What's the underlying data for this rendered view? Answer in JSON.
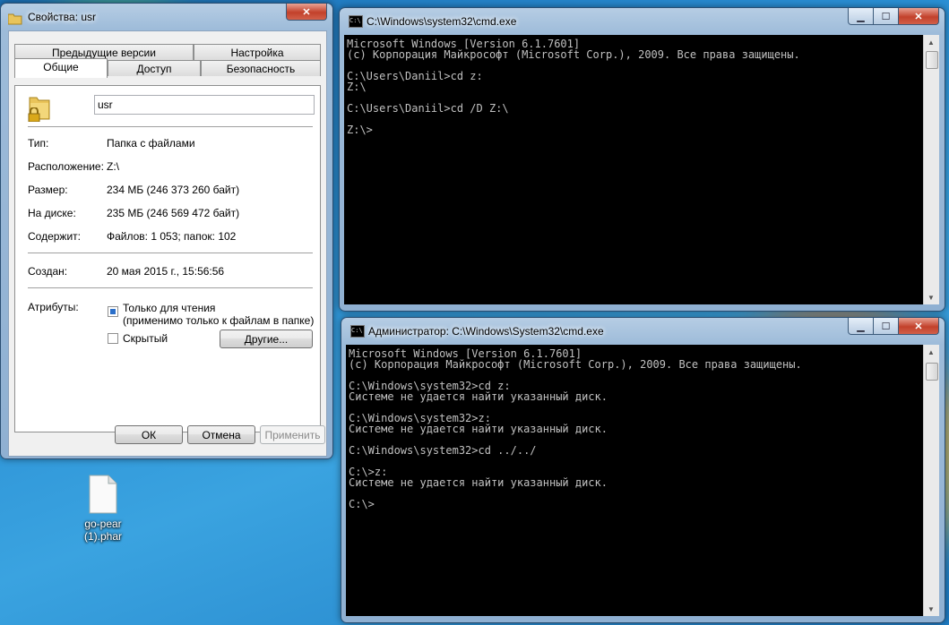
{
  "desktop": {
    "icon_label_line1": "go-pear",
    "icon_label_line2": "(1).phar"
  },
  "properties_window": {
    "title": "Свойства: usr",
    "tabs_row1": [
      "Предыдущие версии",
      "Настройка"
    ],
    "tabs_row2": [
      "Общие",
      "Доступ",
      "Безопасность"
    ],
    "active_tab": "Общие",
    "name_value": "usr",
    "type_label": "Тип:",
    "type_value": "Папка с файлами",
    "location_label": "Расположение:",
    "location_value": "Z:\\",
    "size_label": "Размер:",
    "size_value": "234 МБ (246 373 260 байт)",
    "ondisk_label": "На диске:",
    "ondisk_value": "235 МБ (246 569 472 байт)",
    "contains_label": "Содержит:",
    "contains_value": "Файлов: 1 053; папок: 102",
    "created_label": "Создан:",
    "created_value": "20 мая 2015 г., 15:56:56",
    "attributes_label": "Атрибуты:",
    "readonly_label": "Только для чтения",
    "readonly_note": "(применимо только к файлам в папке)",
    "hidden_label": "Скрытый",
    "other_button": "Другие...",
    "ok_button": "ОК",
    "cancel_button": "Отмена",
    "apply_button": "Применить",
    "close_glyph": "✕"
  },
  "cmd_window_1": {
    "title": "C:\\Windows\\system32\\cmd.exe",
    "lines": [
      "Microsoft Windows [Version 6.1.7601]",
      "(c) Корпорация Майкрософт (Microsoft Corp.), 2009. Все права защищены.",
      "",
      "C:\\Users\\Daniil>cd z:",
      "Z:\\",
      "",
      "C:\\Users\\Daniil>cd /D Z:\\",
      "",
      "Z:\\>"
    ]
  },
  "cmd_window_2": {
    "title": "Администратор: C:\\Windows\\System32\\cmd.exe",
    "lines": [
      "Microsoft Windows [Version 6.1.7601]",
      "(c) Корпорация Майкрософт (Microsoft Corp.), 2009. Все права защищены.",
      "",
      "C:\\Windows\\system32>cd z:",
      "Системе не удается найти указанный диск.",
      "",
      "C:\\Windows\\system32>z:",
      "Системе не удается найти указанный диск.",
      "",
      "C:\\Windows\\system32>cd ../../",
      "",
      "C:\\>z:",
      "Системе не удается найти указанный диск.",
      "",
      "C:\\>"
    ]
  },
  "window_controls": {
    "minimize_glyph": "▁",
    "maximize_glyph": "☐",
    "close_glyph": "✕"
  },
  "icons": [
    "folder-icon",
    "lock-icon",
    "cmd-icon",
    "file-icon",
    "minimize-icon",
    "maximize-icon",
    "close-icon",
    "scroll-up-icon",
    "scroll-down-icon"
  ]
}
